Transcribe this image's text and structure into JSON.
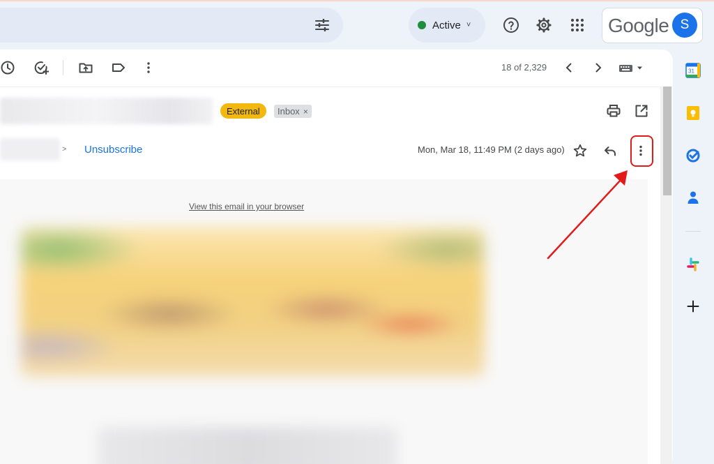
{
  "header": {
    "status": "Active",
    "brand": "Google",
    "avatar_initial": "S"
  },
  "toolbar": {
    "pager": "18 of 2,329"
  },
  "message": {
    "labels": {
      "external": "External",
      "inbox": "Inbox",
      "remove_glyph": "×"
    },
    "sender_separator": ">",
    "unsubscribe": "Unsubscribe",
    "date": "Mon, Mar 18, 11:49 PM (2 days ago)",
    "view_in_browser": "View this email in your browser"
  },
  "colors": {
    "accent": "#1a73e8",
    "status_green": "#1e8e3e",
    "external_label": "#f2b80f",
    "annotation_red": "#e21a1a"
  },
  "icons": {
    "top": [
      "search-options-icon",
      "help-icon",
      "settings-gear-icon",
      "apps-grid-icon"
    ],
    "toolbar": [
      "snooze-clock-icon",
      "add-to-tasks-icon",
      "move-to-folder-icon",
      "label-tag-icon",
      "more-vertical-icon",
      "chevron-left-icon",
      "chevron-right-icon",
      "input-tools-keyboard-icon"
    ],
    "message": [
      "print-icon",
      "open-in-new-window-icon",
      "star-icon",
      "reply-icon",
      "more-vertical-icon"
    ],
    "side_panel": [
      "calendar-icon",
      "keep-icon",
      "tasks-icon",
      "contacts-icon",
      "slack-icon",
      "add-icon"
    ]
  },
  "calendar_day": "31"
}
